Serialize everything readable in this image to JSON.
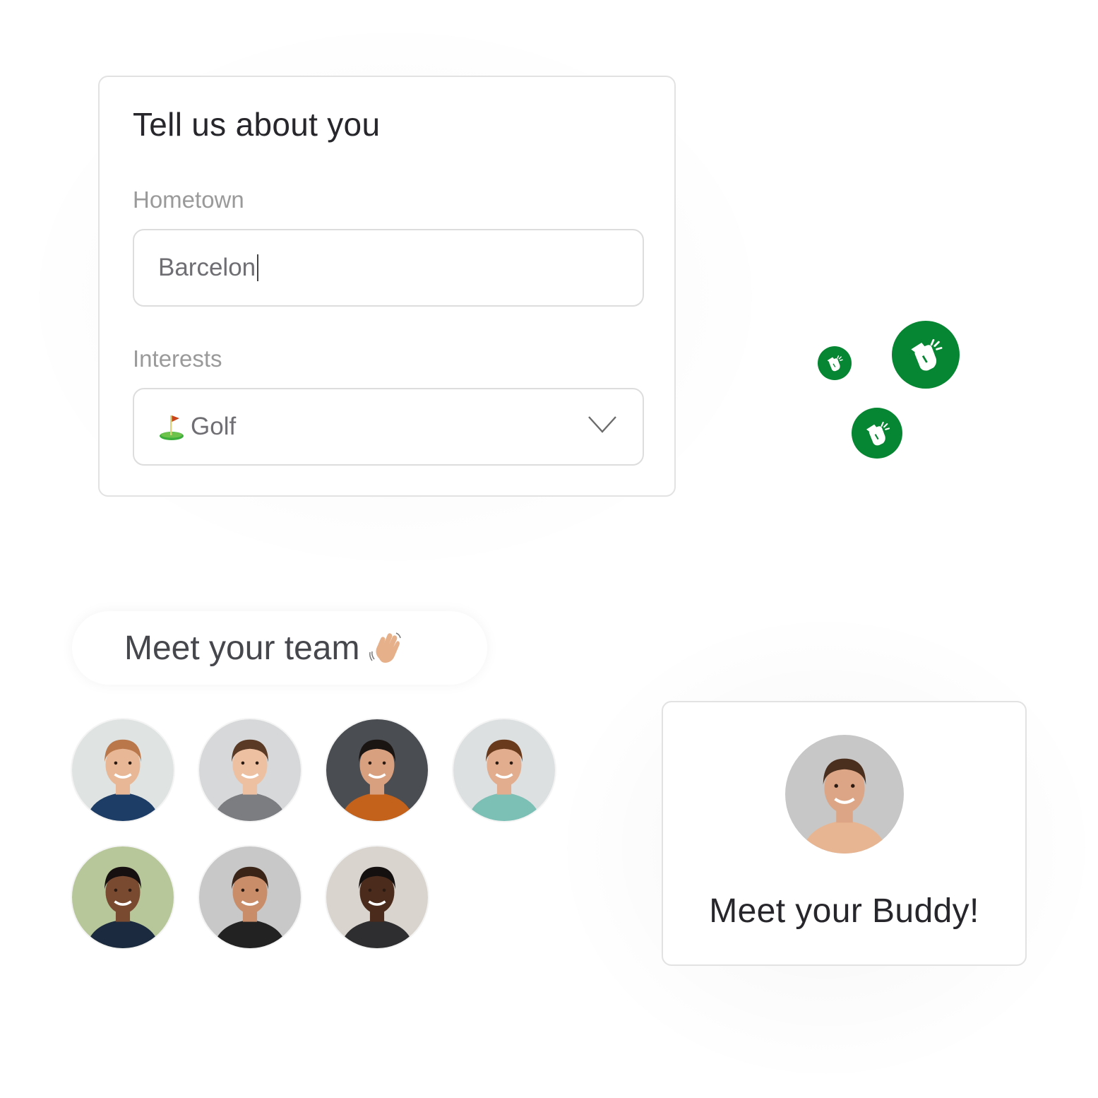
{
  "profile_form": {
    "title": "Tell us about you",
    "hometown": {
      "label": "Hometown",
      "value": "Barcelon"
    },
    "interests": {
      "label": "Interests",
      "selected_value": "Golf",
      "selected_icon": "golf-flag-icon"
    }
  },
  "reactions": {
    "icon": "clapping-hands-icon",
    "count": 3,
    "color": "#068632"
  },
  "team": {
    "heading": "Meet your team",
    "heading_icon": "waving-hand-icon",
    "members": [
      {
        "label": "Team member 1",
        "bg": "#dfe3e2",
        "skin": "#e8b896",
        "hair": "#b9774a",
        "shirt": "#1e3d66"
      },
      {
        "label": "Team member 2",
        "bg": "#d6d8d9",
        "skin": "#eec0a2",
        "hair": "#5a3a24",
        "shirt": "#7b7d80"
      },
      {
        "label": "Team member 3",
        "bg": "#4a4d52",
        "skin": "#d9a080",
        "hair": "#1a1412",
        "shirt": "#c4611a"
      },
      {
        "label": "Team member 4",
        "bg": "#dde0e1",
        "skin": "#e2ad8e",
        "hair": "#6a3a1c",
        "shirt": "#7cbfb5"
      },
      {
        "label": "Team member 5",
        "bg": "#b7c79a",
        "skin": "#7a4a30",
        "hair": "#161010",
        "shirt": "#1b2a3e"
      },
      {
        "label": "Team member 6",
        "bg": "#c8c8c8",
        "skin": "#c98d6a",
        "hair": "#3a2418",
        "shirt": "#222222"
      },
      {
        "label": "Team member 7",
        "bg": "#d9d4ce",
        "skin": "#4b2c1c",
        "hair": "#151010",
        "shirt": "#2e2e30"
      }
    ]
  },
  "buddy": {
    "title": "Meet your Buddy!",
    "avatar": {
      "label": "Buddy",
      "bg": "#c6c7c6",
      "skin": "#dca585",
      "hair": "#4a2e1e",
      "shirt": "#e8b592"
    }
  }
}
